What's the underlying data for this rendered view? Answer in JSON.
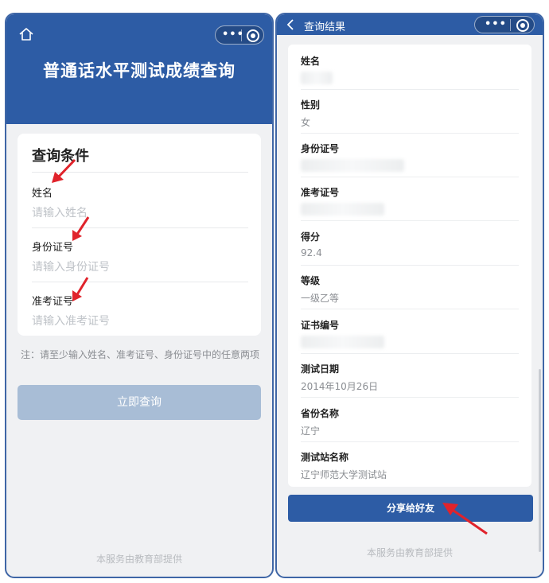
{
  "left": {
    "title": "普通话水平测试成绩查询",
    "card_title": "查询条件",
    "fields": [
      {
        "label": "姓名",
        "placeholder": "请输入姓名"
      },
      {
        "label": "身份证号",
        "placeholder": "请输入身份证号"
      },
      {
        "label": "准考证号",
        "placeholder": "请输入准考证号"
      }
    ],
    "note": "注：请至少输入姓名、准考证号、身份证号中的任意两项",
    "submit_label": "立即查询",
    "footer": "本服务由教育部提供"
  },
  "right": {
    "title": "查询结果",
    "items": [
      {
        "label": "姓名",
        "value": ""
      },
      {
        "label": "性别",
        "value": "女"
      },
      {
        "label": "身份证号",
        "value": ""
      },
      {
        "label": "准考证号",
        "value": ""
      },
      {
        "label": "得分",
        "value": "92.4"
      },
      {
        "label": "等级",
        "value": "一级乙等"
      },
      {
        "label": "证书编号",
        "value": ""
      },
      {
        "label": "测试日期",
        "value": "2014年10月26日"
      },
      {
        "label": "省份名称",
        "value": "辽宁"
      },
      {
        "label": "测试站名称",
        "value": "辽宁师范大学测试站"
      }
    ],
    "share_label": "分享给好友",
    "footer": "本服务由教育部提供"
  },
  "colors": {
    "header": "#2d5ca5",
    "button_disabled": "#a8bdd6",
    "arrow": "#e0232b"
  },
  "icons": [
    "home-icon",
    "more-icon",
    "close-mini-program-icon",
    "back-icon",
    "annotation-arrow"
  ]
}
